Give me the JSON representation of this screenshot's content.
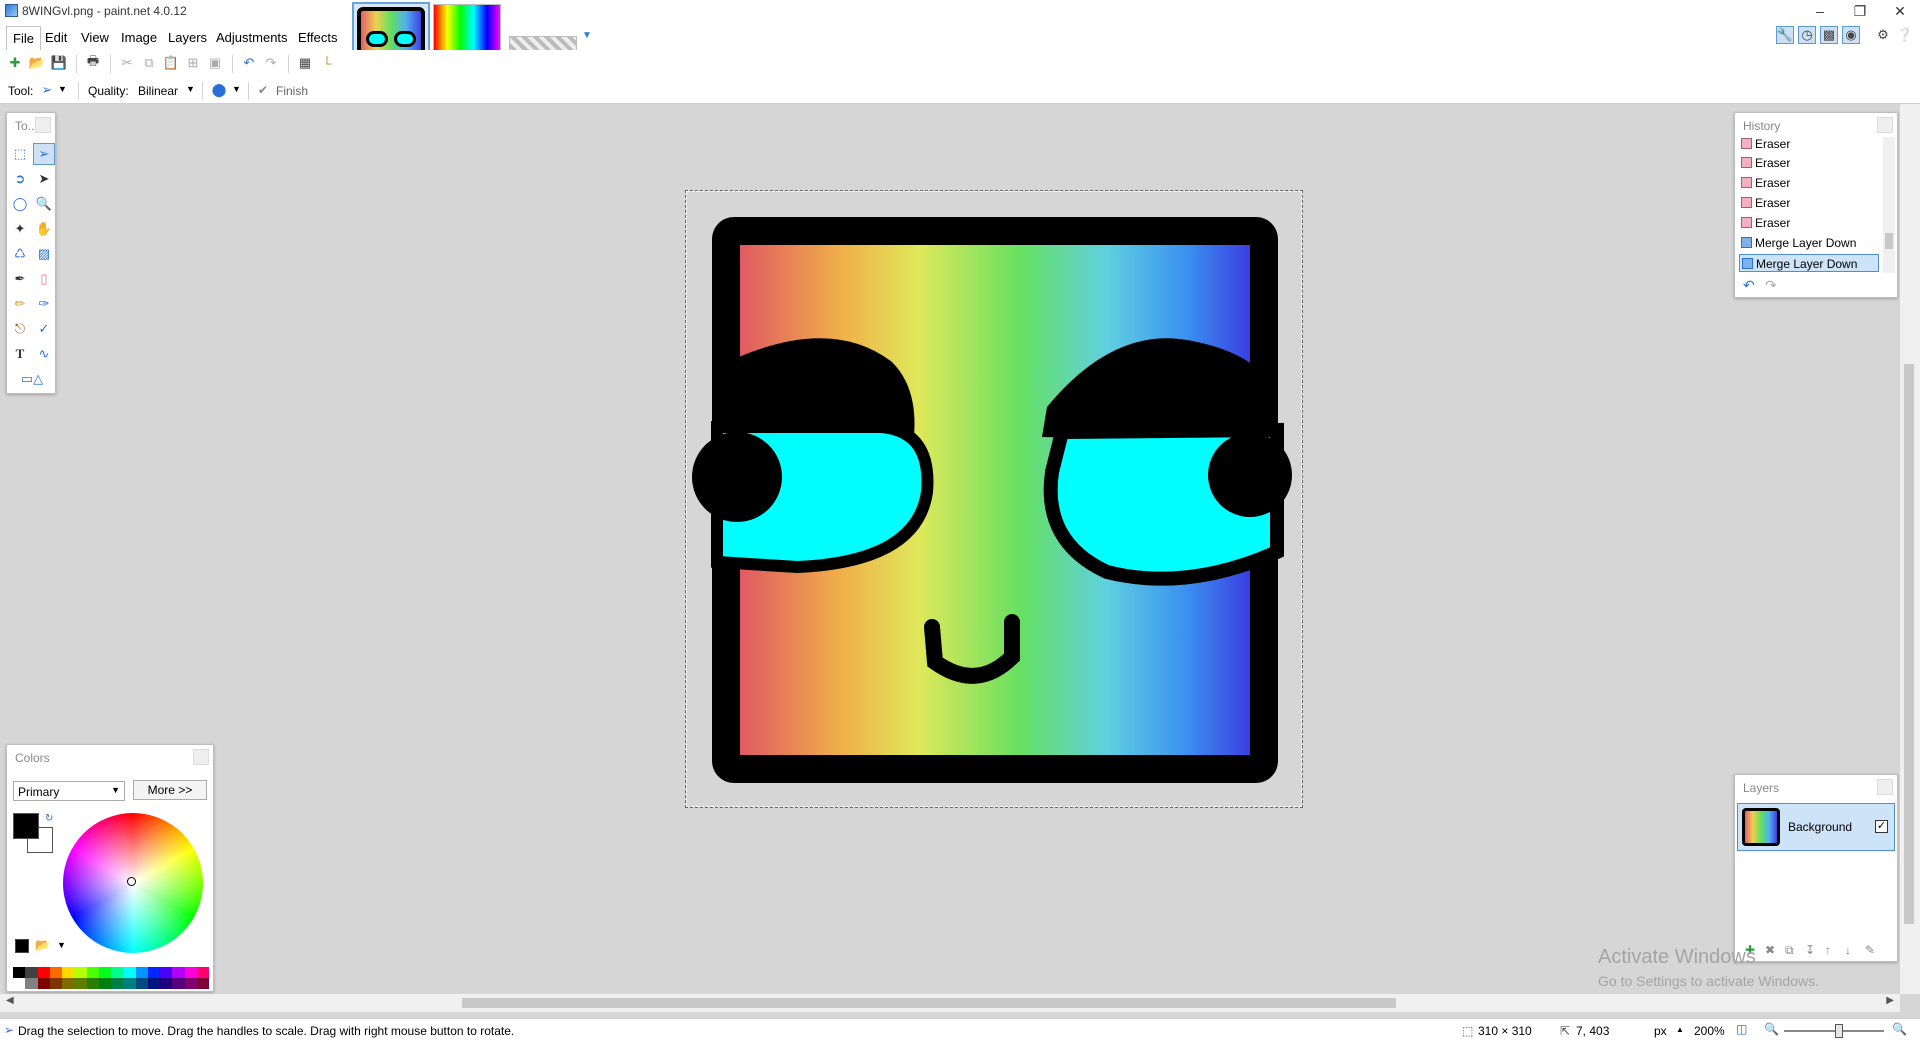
{
  "window": {
    "title": "8WINGvl.png - paint.net 4.0.12"
  },
  "menu": [
    "File",
    "Edit",
    "View",
    "Image",
    "Layers",
    "Adjustments",
    "Effects"
  ],
  "toolbar2": {
    "tool_label": "Tool:",
    "quality_label": "Quality:",
    "quality_value": "Bilinear",
    "finish_label": "Finish"
  },
  "tools_panel": {
    "title": "To..."
  },
  "history": {
    "title": "History",
    "items": [
      {
        "label": "Eraser",
        "icon": "eraser-icon"
      },
      {
        "label": "Eraser",
        "icon": "eraser-icon"
      },
      {
        "label": "Eraser",
        "icon": "eraser-icon"
      },
      {
        "label": "Eraser",
        "icon": "eraser-icon"
      },
      {
        "label": "Eraser",
        "icon": "eraser-icon"
      },
      {
        "label": "Merge Layer Down",
        "icon": "merge-layer-icon"
      },
      {
        "label": "Merge Layer Down",
        "icon": "merge-layer-icon",
        "selected": true
      }
    ]
  },
  "layers": {
    "title": "Layers",
    "items": [
      {
        "label": "Background",
        "visible": true
      }
    ]
  },
  "colors": {
    "title": "Colors",
    "mode_value": "Primary",
    "more_label": "More >>",
    "primary": "#000000",
    "secondary": "#ffffff",
    "palette": [
      "#000000",
      "#404040",
      "#ff0000",
      "#ff6a00",
      "#ffd800",
      "#b6ff00",
      "#4cff00",
      "#00ff21",
      "#00ff90",
      "#00ffff",
      "#0094ff",
      "#0026ff",
      "#4800ff",
      "#b200ff",
      "#ff00dc",
      "#ff006e",
      "#ffffff",
      "#808080",
      "#7f0000",
      "#7f3300",
      "#7f6a00",
      "#5b7f00",
      "#267f00",
      "#007f0e",
      "#007f46",
      "#007f7f",
      "#004a7f",
      "#00137f",
      "#21007f",
      "#57007f",
      "#7f006e",
      "#7f0037"
    ]
  },
  "statusbar": {
    "hint": "Drag the selection to move. Drag the handles to scale. Drag with right mouse button to rotate.",
    "selection_size": "310 × 310",
    "cursor_pos": "7, 403",
    "units": "px",
    "zoom": "200%",
    "zoom_slider_fraction": 0.55
  },
  "watermark": {
    "line1": "Activate Windows",
    "line2": "Go to Settings to activate Windows."
  }
}
